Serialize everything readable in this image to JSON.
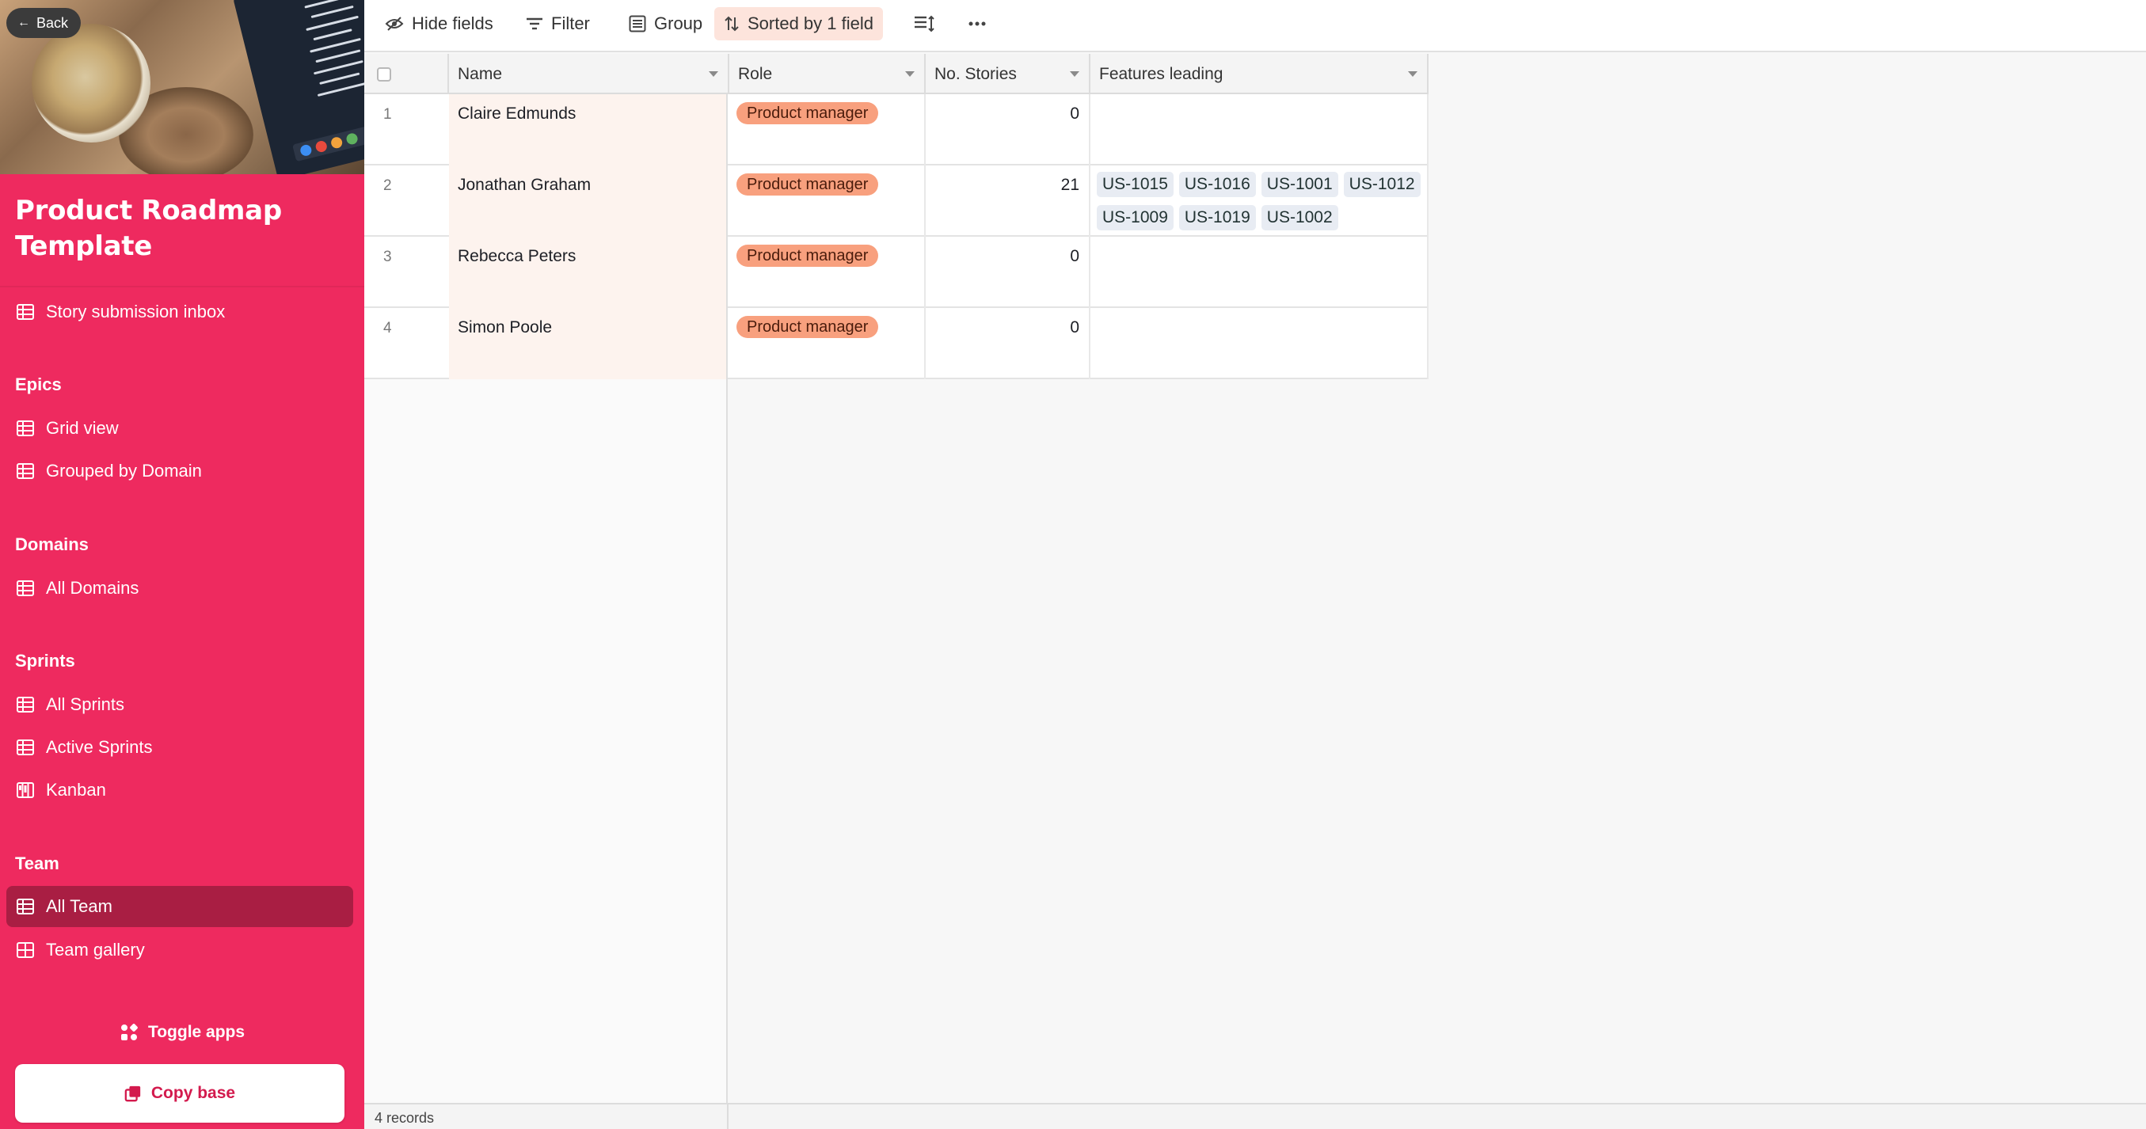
{
  "sidebar": {
    "back_label": "Back",
    "base_title": "Product Roadmap Template",
    "top_item": {
      "label": "Story submission inbox",
      "icon": "grid-icon"
    },
    "sections": [
      {
        "title": "Epics",
        "items": [
          {
            "label": "Grid view",
            "icon": "grid-icon"
          },
          {
            "label": "Grouped by Domain",
            "icon": "grid-icon"
          }
        ]
      },
      {
        "title": "Domains",
        "items": [
          {
            "label": "All Domains",
            "icon": "grid-icon"
          }
        ]
      },
      {
        "title": "Sprints",
        "items": [
          {
            "label": "All Sprints",
            "icon": "grid-icon"
          },
          {
            "label": "Active Sprints",
            "icon": "grid-icon"
          },
          {
            "label": "Kanban",
            "icon": "kanban-icon"
          }
        ]
      },
      {
        "title": "Team",
        "items": [
          {
            "label": "All Team",
            "icon": "grid-icon",
            "active": true
          },
          {
            "label": "Team gallery",
            "icon": "gallery-icon"
          }
        ]
      }
    ],
    "toggle_apps_label": "Toggle apps",
    "copy_base_label": "Copy base"
  },
  "toolbar": {
    "hide_fields": "Hide fields",
    "filter": "Filter",
    "group": "Group",
    "sorted": "Sorted by 1 field"
  },
  "grid": {
    "columns": {
      "name": "Name",
      "role": "Role",
      "stories": "No. Stories",
      "features": "Features leading"
    },
    "rows": [
      {
        "num": "1",
        "name": "Claire Edmunds",
        "role": "Product manager",
        "stories": "0",
        "features": []
      },
      {
        "num": "2",
        "name": "Jonathan Graham",
        "role": "Product manager",
        "stories": "21",
        "features": [
          "US-1015",
          "US-1016",
          "US-1001",
          "US-1012",
          "US-1009",
          "US-1019",
          "US-1002"
        ]
      },
      {
        "num": "3",
        "name": "Rebecca Peters",
        "role": "Product manager",
        "stories": "0",
        "features": []
      },
      {
        "num": "4",
        "name": "Simon Poole",
        "role": "Product manager",
        "stories": "0",
        "features": []
      }
    ]
  },
  "footer": {
    "record_count": "4 records"
  },
  "colors": {
    "sidebar": "#ee2a5f",
    "active_nav": "#a91e43",
    "role_pill": "#f8a07e",
    "sorted_bg": "#fde4dc"
  }
}
